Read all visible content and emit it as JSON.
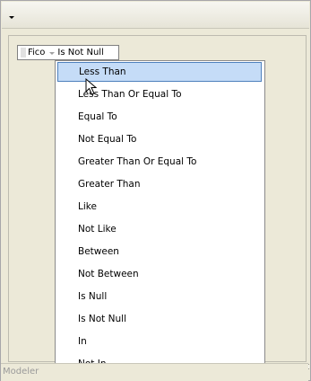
{
  "filter_chip": {
    "field": "Fico",
    "operator": "Is Not Null"
  },
  "operator_menu": {
    "selected_index": 0,
    "items": [
      "Less Than",
      "Less Than Or Equal To",
      "Equal To",
      "Not Equal To",
      "Greater Than Or Equal To",
      "Greater Than",
      "Like",
      "Not Like",
      "Between",
      "Not Between",
      "Is Null",
      "Is Not Null",
      "In",
      "Not In"
    ]
  },
  "bottom_tab": {
    "label": "Modeler"
  },
  "icons": {
    "toolbar_dropdown": "chevron-down-icon",
    "chip_dropdown": "chevron-down-icon",
    "grip": "grip-icon",
    "cursor": "mouse-pointer-icon"
  }
}
